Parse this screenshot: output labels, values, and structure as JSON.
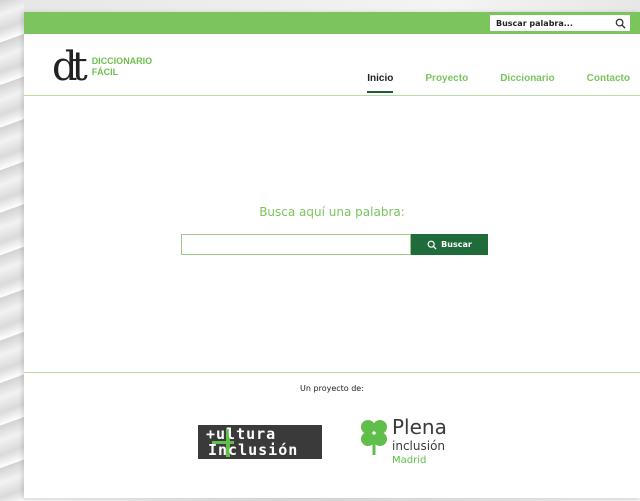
{
  "top_search": {
    "placeholder": "Buscar palabra..."
  },
  "logo": {
    "mark": "dt",
    "line1": "DICCIONARIO",
    "line2": "FÁCIL"
  },
  "nav": {
    "items": [
      "Inicio",
      "Proyecto",
      "Diccionario",
      "Contacto"
    ],
    "active": "Inicio"
  },
  "main": {
    "prompt": "Busca aquí una palabra:",
    "search_value": "",
    "search_button": "Buscar"
  },
  "footer": {
    "label": "Un proyecto de:",
    "cultura_line1": "+ultura",
    "cultura_line2": "Inclusión",
    "plena_word": "Plena",
    "plena_sub": "inclusión",
    "plena_city": "Madrid"
  },
  "colors": {
    "green": "#7bc45e",
    "dark_green": "#1f6b3a"
  },
  "icons": {
    "search": "search-icon",
    "clover": "clover-icon"
  }
}
